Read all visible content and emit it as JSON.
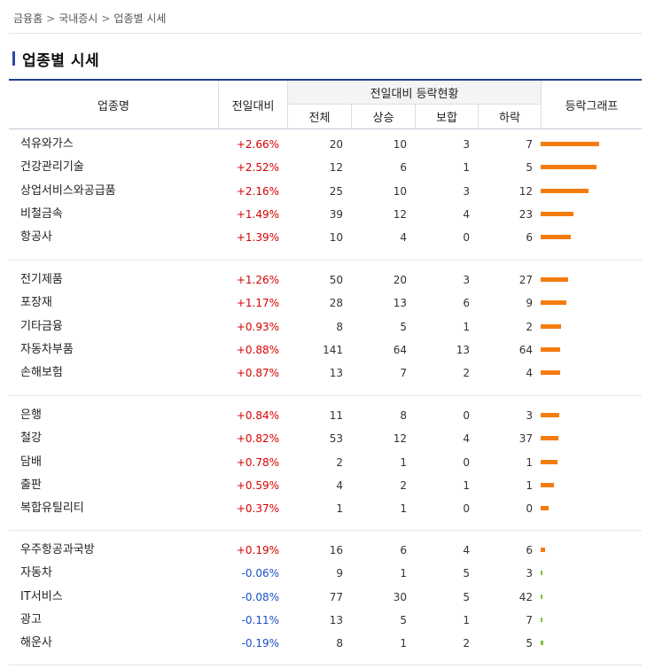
{
  "breadcrumb": [
    "금융홈",
    "국내증시",
    "업종별 시세"
  ],
  "breadcrumb_sep": ">",
  "page_title": "업종별 시세",
  "headers": {
    "name": "업종명",
    "change": "전일대비",
    "status_group": "전일대비 등락현황",
    "total": "전체",
    "up": "상승",
    "flat": "보합",
    "down": "하락",
    "graph": "등락그래프"
  },
  "colors": {
    "up_bar": "#f47c0e",
    "down_bar": "#7cc43c",
    "up_text": "#d60000",
    "down_text": "#1a50c8"
  },
  "groups": [
    [
      {
        "name": "석유와가스",
        "change": "+2.66%",
        "dir": "up",
        "total": "20",
        "up": "10",
        "flat": "3",
        "down": "7",
        "pct": 2.66
      },
      {
        "name": "건강관리기술",
        "change": "+2.52%",
        "dir": "up",
        "total": "12",
        "up": "6",
        "flat": "1",
        "down": "5",
        "pct": 2.52
      },
      {
        "name": "상업서비스와공급품",
        "change": "+2.16%",
        "dir": "up",
        "total": "25",
        "up": "10",
        "flat": "3",
        "down": "12",
        "pct": 2.16
      },
      {
        "name": "비철금속",
        "change": "+1.49%",
        "dir": "up",
        "total": "39",
        "up": "12",
        "flat": "4",
        "down": "23",
        "pct": 1.49
      },
      {
        "name": "항공사",
        "change": "+1.39%",
        "dir": "up",
        "total": "10",
        "up": "4",
        "flat": "0",
        "down": "6",
        "pct": 1.39
      }
    ],
    [
      {
        "name": "전기제품",
        "change": "+1.26%",
        "dir": "up",
        "total": "50",
        "up": "20",
        "flat": "3",
        "down": "27",
        "pct": 1.26
      },
      {
        "name": "포장재",
        "change": "+1.17%",
        "dir": "up",
        "total": "28",
        "up": "13",
        "flat": "6",
        "down": "9",
        "pct": 1.17
      },
      {
        "name": "기타금융",
        "change": "+0.93%",
        "dir": "up",
        "total": "8",
        "up": "5",
        "flat": "1",
        "down": "2",
        "pct": 0.93
      },
      {
        "name": "자동차부품",
        "change": "+0.88%",
        "dir": "up",
        "total": "141",
        "up": "64",
        "flat": "13",
        "down": "64",
        "pct": 0.88
      },
      {
        "name": "손해보험",
        "change": "+0.87%",
        "dir": "up",
        "total": "13",
        "up": "7",
        "flat": "2",
        "down": "4",
        "pct": 0.87
      }
    ],
    [
      {
        "name": "은행",
        "change": "+0.84%",
        "dir": "up",
        "total": "11",
        "up": "8",
        "flat": "0",
        "down": "3",
        "pct": 0.84
      },
      {
        "name": "철강",
        "change": "+0.82%",
        "dir": "up",
        "total": "53",
        "up": "12",
        "flat": "4",
        "down": "37",
        "pct": 0.82
      },
      {
        "name": "담배",
        "change": "+0.78%",
        "dir": "up",
        "total": "2",
        "up": "1",
        "flat": "0",
        "down": "1",
        "pct": 0.78
      },
      {
        "name": "출판",
        "change": "+0.59%",
        "dir": "up",
        "total": "4",
        "up": "2",
        "flat": "1",
        "down": "1",
        "pct": 0.59
      },
      {
        "name": "복합유틸리티",
        "change": "+0.37%",
        "dir": "up",
        "total": "1",
        "up": "1",
        "flat": "0",
        "down": "0",
        "pct": 0.37
      }
    ],
    [
      {
        "name": "우주항공과국방",
        "change": "+0.19%",
        "dir": "up",
        "total": "16",
        "up": "6",
        "flat": "4",
        "down": "6",
        "pct": 0.19
      },
      {
        "name": "자동차",
        "change": "-0.06%",
        "dir": "down",
        "total": "9",
        "up": "1",
        "flat": "5",
        "down": "3",
        "pct": 0.06
      },
      {
        "name": "IT서비스",
        "change": "-0.08%",
        "dir": "down",
        "total": "77",
        "up": "30",
        "flat": "5",
        "down": "42",
        "pct": 0.08
      },
      {
        "name": "광고",
        "change": "-0.11%",
        "dir": "down",
        "total": "13",
        "up": "5",
        "flat": "1",
        "down": "7",
        "pct": 0.11
      },
      {
        "name": "해운사",
        "change": "-0.19%",
        "dir": "down",
        "total": "8",
        "up": "1",
        "flat": "2",
        "down": "5",
        "pct": 0.19
      }
    ]
  ]
}
